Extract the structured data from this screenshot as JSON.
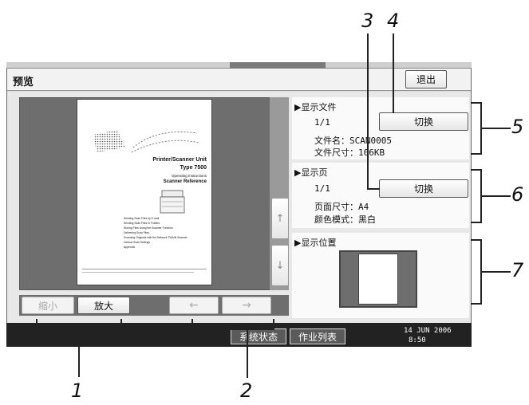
{
  "window": {
    "title": "预览",
    "exit_label": "退出"
  },
  "preview": {
    "zoom_out_label": "缩小",
    "zoom_in_label": "放大",
    "arrow_left": "←",
    "arrow_right": "→",
    "arrow_up": "↑",
    "arrow_down": "↓",
    "doc": {
      "title1": "Printer/Scanner Unit",
      "title2": "Type 7500",
      "subtitle1": "Operating Instructions",
      "subtitle2": "Scanner Reference",
      "toc": [
        "Sending Scan Files by E-mail",
        "Sending Scan Files to Folders",
        "Storing Files Using the Scanner Function",
        "Delivering Scan Files",
        "Scanning Originals with the Network TWAIN Scanner",
        "Various Scan Settings",
        "Appendix"
      ]
    }
  },
  "file_panel": {
    "title": "▶显示文件",
    "counter": "1/1",
    "switch_label": "切换",
    "filename_line": "文件名：SCAN0005",
    "filesize_line": "文件尺寸：106KB"
  },
  "page_panel": {
    "title": "▶显示页",
    "counter": "1/1",
    "switch_label": "切换",
    "pagesize_line": "页面尺寸：A4",
    "colormode_line": "颜色模式：黑白"
  },
  "position_panel": {
    "title": "▶显示位置"
  },
  "taskbar": {
    "system_status": "系统状态",
    "job_list": "作业列表",
    "date": "14 JUN  2006",
    "time": "8:50"
  },
  "callouts": {
    "c1": "1",
    "c2": "2",
    "c3": "3",
    "c4": "4",
    "c5": "5",
    "c6": "6",
    "c7": "7"
  }
}
